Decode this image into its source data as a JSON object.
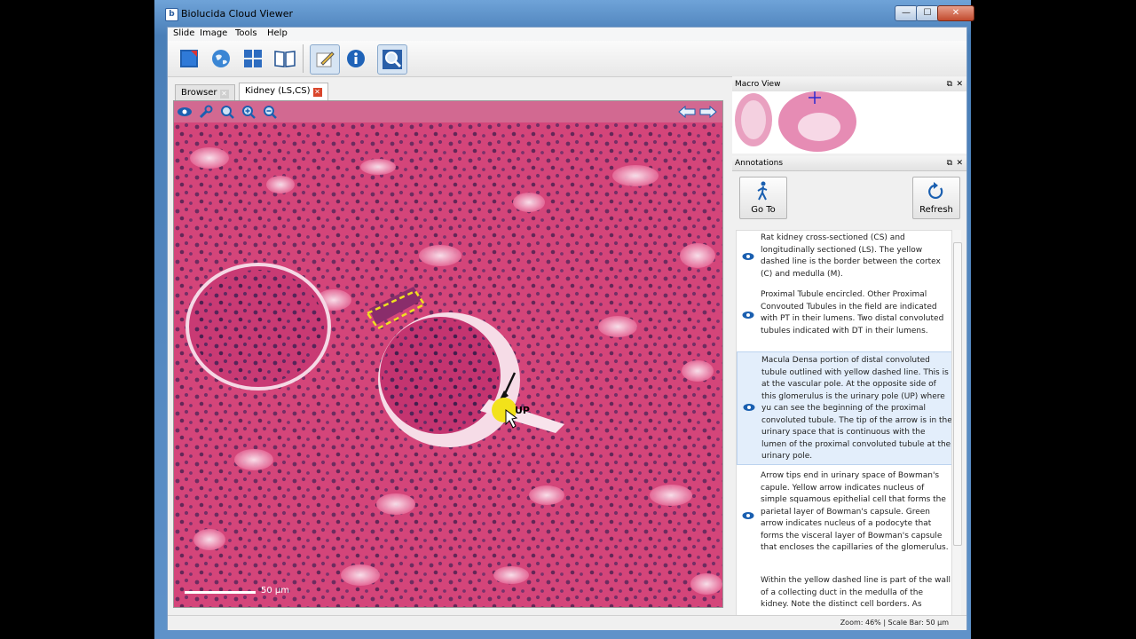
{
  "window": {
    "title": "Biolucida Cloud Viewer",
    "app_icon": "b",
    "controls": {
      "minimize": "—",
      "maximize": "☐",
      "close": "✕"
    }
  },
  "menu": [
    "Slide",
    "Image",
    "Tools",
    "Help"
  ],
  "toolbar": {
    "icons": [
      "close-slide-icon",
      "globe-icon",
      "tiles-icon",
      "book-icon",
      "pencil-annotate-icon",
      "info-icon",
      "magnify-search-icon"
    ],
    "active": [
      "pencil-annotate-icon",
      "magnify-search-icon"
    ]
  },
  "tabs": [
    {
      "label": "Browser",
      "close": "✕",
      "active": false
    },
    {
      "label": "Kidney (LS,CS)",
      "close": "✕",
      "active": true
    }
  ],
  "viewer": {
    "tools": [
      "eye-icon",
      "wrench-icon",
      "zoom-fit-icon",
      "zoom-in-icon",
      "zoom-out-icon"
    ],
    "nav": [
      "arrow-left-icon",
      "arrow-right-icon"
    ],
    "scale_bar": "50 µm",
    "marker_label": "UP"
  },
  "macro_panel": {
    "title": "Macro View",
    "dock": "⧉",
    "close": "✕"
  },
  "annotations_panel": {
    "title": "Annotations",
    "dock": "⧉",
    "close": "✕",
    "goto_label": "Go To",
    "refresh_label": "Refresh",
    "items": [
      {
        "text": "Rat kidney cross-sectioned (CS) and longitudinally sectioned (LS).  The yellow dashed line is the border between the cortex (C) and medulla (M).",
        "selected": false
      },
      {
        "text": "Proximal Tubule encircled.  Other Proximal Convouted Tubules in the field are indicated with PT in their lumens.  Two distal convoluted tubules indicated with DT in their lumens.",
        "selected": false
      },
      {
        "text": "Macula Densa portion of distal convoluted tubule outlined with yellow dashed line. This is at the vascular pole.  At  the opposite side of this glomerulus is the urinary pole (UP) where yu can see the beginning of the proximal convoluted tubule. The tip of the arrow is in the urinary space that is continuous with the lumen of the proximal convoluted tubule at the urinary pole.",
        "selected": true
      },
      {
        "text": "Arrow tips end in urinary space of Bowman's capule. Yellow arrow indicates nucleus of simple squamous epithelial cell that forms the parietal layer of Bowman's capsule. Green arrow indicates nucleus of a podocyte that forms the visceral layer of Bowman's capsule that encloses the capillaries of the glomerulus.",
        "selected": false
      },
      {
        "text": "Within the yellow dashed line is part of the wall of a collecting duct in the medulla of the kidney.  Note the distinct cell borders.  As",
        "selected": false
      }
    ]
  },
  "status": "Zoom: 46% | Scale Bar: 50 µm"
}
